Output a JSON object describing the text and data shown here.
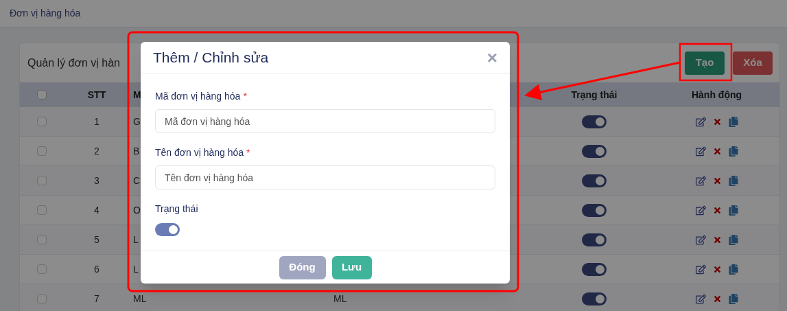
{
  "breadcrumb": {
    "current": "Đơn vị hàng hóa"
  },
  "card": {
    "title": "Quản lý đơn vị hàn",
    "buttons": [
      {
        "label": "Tạo",
        "kind": "create"
      },
      {
        "label": "Xóa",
        "kind": "delete"
      }
    ]
  },
  "table": {
    "all_checked": false,
    "columns": [
      {
        "label": "STT"
      },
      {
        "label": "M"
      },
      {
        "label": "Trạng thái"
      },
      {
        "label": "Hành động"
      }
    ],
    "rows": [
      {
        "stt": "1",
        "code": "G",
        "on": true,
        "checked": false
      },
      {
        "stt": "2",
        "code": "B",
        "on": true,
        "checked": false
      },
      {
        "stt": "3",
        "code": "C",
        "on": true,
        "checked": false
      },
      {
        "stt": "4",
        "code": "O",
        "on": true,
        "checked": false
      },
      {
        "stt": "5",
        "code": "L",
        "on": true,
        "checked": false
      },
      {
        "stt": "6",
        "code": "L",
        "on": true,
        "checked": false
      },
      {
        "stt": "7",
        "code": "ML",
        "name": "ML",
        "on": true,
        "checked": false
      }
    ]
  },
  "modal": {
    "title": "Thêm / Chỉnh sửa",
    "close": "×",
    "fields": [
      {
        "label": "Mã đơn vị hàng hóa",
        "required_mark": "*",
        "placeholder": "Mã đơn vị hàng hóa"
      },
      {
        "label": "Tên đơn vị hàng hóa",
        "required_mark": "*",
        "placeholder": "Tên đơn vị hàng hóa"
      }
    ],
    "status": {
      "label": "Trạng thái",
      "on": true
    },
    "buttons": [
      {
        "label": "Đóng",
        "kind": "secondary"
      },
      {
        "label": "Lưu",
        "kind": "primary"
      }
    ]
  }
}
